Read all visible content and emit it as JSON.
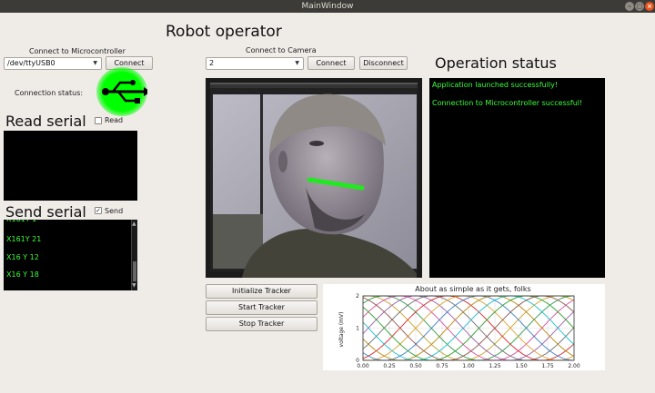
{
  "window": {
    "title": "MainWindow"
  },
  "app_title": "Robot  operator",
  "microcontroller": {
    "label": "Connect to Microcontroller",
    "port": "/dev/ttyUSB0",
    "connect_label": "Connect",
    "status_label": "Connection status:",
    "status_icon": "usb-icon",
    "status_color": "#00ff00"
  },
  "read_serial": {
    "title": "Read serial",
    "checkbox_label": "Read",
    "checked": false
  },
  "send_serial": {
    "title": "Send serial",
    "checkbox_label": "Send",
    "checked": true,
    "lines": [
      "X161Y 21",
      "X16 Y 12",
      "X16 Y 18"
    ]
  },
  "camera": {
    "label": "Connect to Camera",
    "selected": "2",
    "connect_label": "Connect",
    "disconnect_label": "Disconnect"
  },
  "tracker": {
    "initialize_label": "Initialize Tracker",
    "start_label": "Start Tracker",
    "stop_label": "Stop Tracker"
  },
  "operation_status": {
    "title": "Operation status",
    "messages": [
      "Application launched successfully!",
      "Connection to Microcontroller successful!"
    ]
  },
  "chart_data": {
    "type": "line",
    "title": "About as simple as it gets, folks",
    "ylabel": "voltage (mV)",
    "xlim": [
      0,
      2
    ],
    "ylim": [
      0,
      2
    ],
    "x_ticks": [
      "0.00",
      "0.25",
      "0.50",
      "0.75",
      "1.00",
      "1.25",
      "1.50",
      "1.75",
      "2.00"
    ],
    "y_ticks": [
      "0",
      "1",
      "2"
    ],
    "grid": true,
    "series_offsets": [
      0.0,
      0.15,
      0.3,
      0.45,
      0.6,
      0.75,
      0.9,
      1.05,
      1.2,
      1.35,
      1.5,
      1.65
    ],
    "series_colors": [
      "#c9a227",
      "#2e9b4a",
      "#d94f9c",
      "#9a5ea8",
      "#6f6f6f",
      "#d62728",
      "#e0a030",
      "#3b7fc4",
      "#b8860b",
      "#17becf",
      "#2ca02c",
      "#8c564b"
    ]
  }
}
